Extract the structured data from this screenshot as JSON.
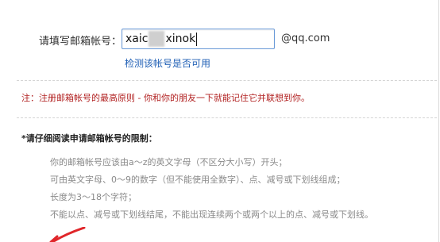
{
  "form": {
    "label": "请填写邮箱帐号：",
    "input_prefix": "xaic",
    "input_suffix": "xinok",
    "domain_suffix": "@qq.com",
    "check_link": "检测该帐号是否可用"
  },
  "note": "注：注册邮箱帐号的最高原则 - 你和你的朋友一下就能记住它并联想到你。",
  "rules": {
    "title": "*请仔细阅读申请邮箱帐号的限制：",
    "items": [
      "你的邮箱帐号应该由a～z的英文字母（不区分大小写）开头；",
      "可由英文字母、0～9的数字（但不能使用全数字）、点、减号或下划线组成；",
      "长度为3～18个字符；",
      "不能以点、减号或下划线结尾，不能出现连续两个或两个以上的点、减号或下划线。"
    ]
  },
  "colors": {
    "note": "#b22222",
    "link": "#1f5fb5",
    "input_border": "#6a9ad8",
    "rule_text": "#8a8a8a",
    "arrow": "#e0262a"
  },
  "icons": {
    "arrow": "red-arrow-annotation-icon"
  }
}
